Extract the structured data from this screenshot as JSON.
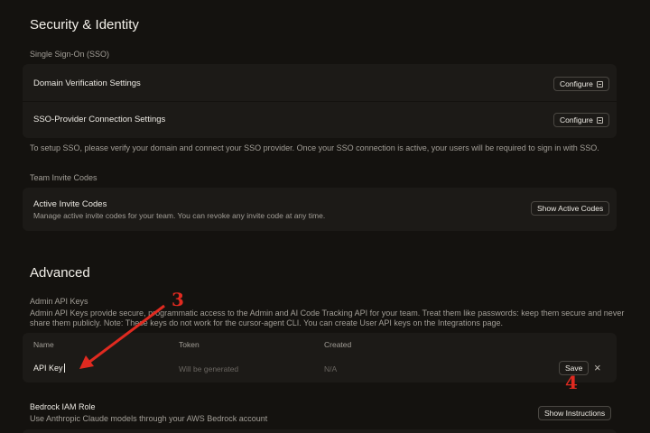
{
  "security": {
    "title": "Security & Identity",
    "sso_label": "Single Sign-On (SSO)",
    "rows": [
      {
        "label": "Domain Verification Settings",
        "button": "Configure"
      },
      {
        "label": "SSO-Provider Connection Settings",
        "button": "Configure"
      }
    ],
    "sso_note": "To setup SSO, please verify your domain and connect your SSO provider. Once your SSO connection is active, your users will be required to sign in with SSO.",
    "invite_label": "Team Invite Codes",
    "invite_title": "Active Invite Codes",
    "invite_desc": "Manage active invite codes for your team. You can revoke any invite code at any time.",
    "invite_button": "Show Active Codes"
  },
  "advanced": {
    "title": "Advanced",
    "api_label": "Admin API Keys",
    "api_desc_1": "Admin API Keys provide secure, programmatic access to the Admin and AI Code Tracking API for your team. Treat them like passwords: keep them secure and never",
    "api_desc_2": "share them publicly. Note: These keys do not work for the cursor-agent CLI. You can create User API keys on the Integrations page.",
    "columns": {
      "name": "Name",
      "token": "Token",
      "created": "Created"
    },
    "row": {
      "name_value": "API Key",
      "token_placeholder": "Will be generated",
      "created_placeholder": "N/A",
      "save": "Save",
      "close": "×"
    },
    "bedrock_title": "Bedrock IAM Role",
    "bedrock_desc": "Use Anthropic Claude models through your AWS Bedrock account",
    "bedrock_button": "Show Instructions"
  },
  "annotations": {
    "arrow_label": "3",
    "save_label": "4",
    "color": "#e02a20"
  }
}
